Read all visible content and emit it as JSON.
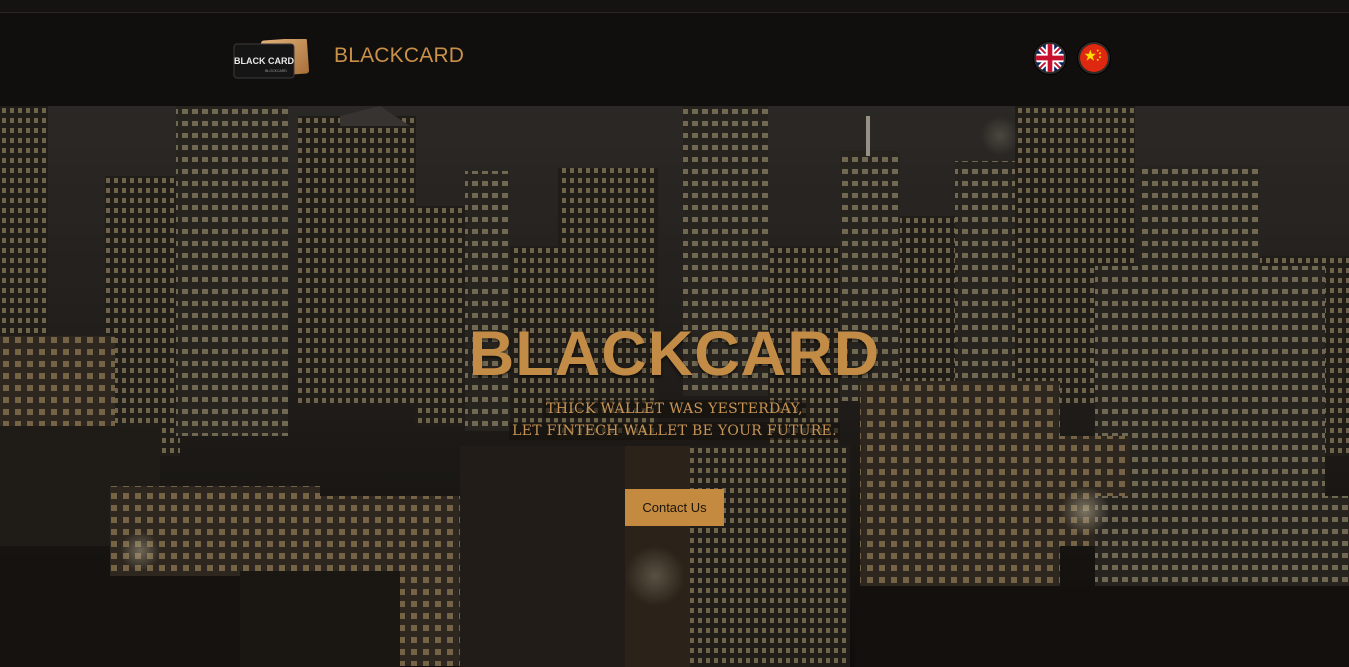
{
  "header": {
    "brand": "BLACKCARD",
    "logo_text_line1": "BLACK CARD",
    "logo_text_line2": "BLOCKCARD",
    "languages": [
      {
        "name": "English",
        "icon": "uk-flag-icon"
      },
      {
        "name": "Chinese",
        "icon": "china-flag-icon"
      }
    ]
  },
  "hero": {
    "title": "BLACKCARD",
    "subtitle_line1": "THICK WALLET WAS YESTERDAY,",
    "subtitle_line2": "LET FINTECH WALLET BE YOUR FUTURE.",
    "cta_label": "Contact Us",
    "background": "night-city-skyline-photo"
  },
  "colors": {
    "accent": "#c28b46",
    "header_bg": "#110f0e",
    "button_bg": "#c48a3f"
  }
}
